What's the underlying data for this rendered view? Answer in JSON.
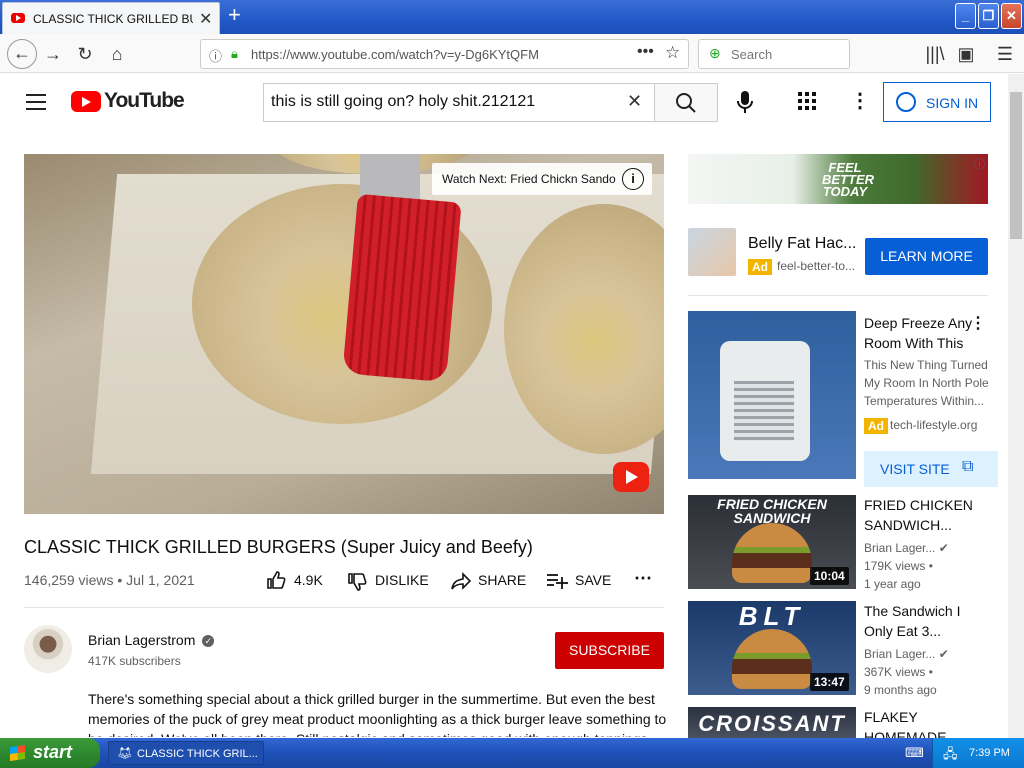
{
  "browser": {
    "tab_title": "CLASSIC THICK GRILLED BURGERS (Super Juicy and Beefy)",
    "tab_close": "✕",
    "new_tab": "+",
    "url": "https://www.youtube.com/watch?v=y-Dg6KYtQFM",
    "search_placeholder": "Search",
    "window_min": "_",
    "window_max": "❐",
    "window_close": "✕"
  },
  "youtube": {
    "logo_text": "YouTube",
    "search_query": "this is still going on? holy shit.212121",
    "sign_in": "SIGN IN",
    "colors": {
      "brand_red": "#ff0000",
      "link_blue": "#065fd4",
      "subscribe_red": "#cc0000"
    }
  },
  "video": {
    "watch_next": "Watch Next: Fried Chickn Sando",
    "title": "CLASSIC THICK GRILLED BURGERS (Super Juicy and Beefy)",
    "meta": "146,259 views • Jul 1, 2021",
    "likes": "4.9K",
    "dislike": "DISLIKE",
    "share": "SHARE",
    "save": "SAVE",
    "channel_name": "Brian Lagerstrom",
    "subscribers": "417K subscribers",
    "subscribe": "SUBSCRIBE",
    "description": "There's something special about a thick grilled burger in the summertime. But even the best memories of the puck of grey meat product moonlighting as a thick burger leave something to be desired. We've all been there. Still nostalgic and sometimes good with enough toppings"
  },
  "sidebar": {
    "banner_text": "FEEL BETTER TODAY",
    "ad1": {
      "title": "Belly Fat Hac...",
      "badge": "Ad",
      "domain": "feel-better-to...",
      "cta": "LEARN MORE"
    },
    "ad2": {
      "title": "Deep Freeze Any Room With This",
      "desc": "This New Thing Turned My Room In North Pole Temperatures Within...",
      "badge": "Ad",
      "domain": "tech-lifestyle.org",
      "cta": "VISIT SITE"
    },
    "videos": [
      {
        "thumb_text": "FRIED CHICKEN SANDWICH",
        "duration": "10:04",
        "title": "FRIED CHICKEN SANDWICH...",
        "channel": "Brian Lager...",
        "views": "179K views •",
        "age": "1 year ago"
      },
      {
        "thumb_text": "BLT",
        "duration": "13:47",
        "title": "The Sandwich I Only Eat 3...",
        "channel": "Brian Lager...",
        "views": "367K views •",
        "age": "9 months ago"
      },
      {
        "thumb_text": "CROISSANT",
        "title": "FLAKEY HOMEMADE"
      }
    ]
  },
  "taskbar": {
    "start": "start",
    "item": "CLASSIC THICK GRIL...",
    "time": "7:39 PM"
  }
}
